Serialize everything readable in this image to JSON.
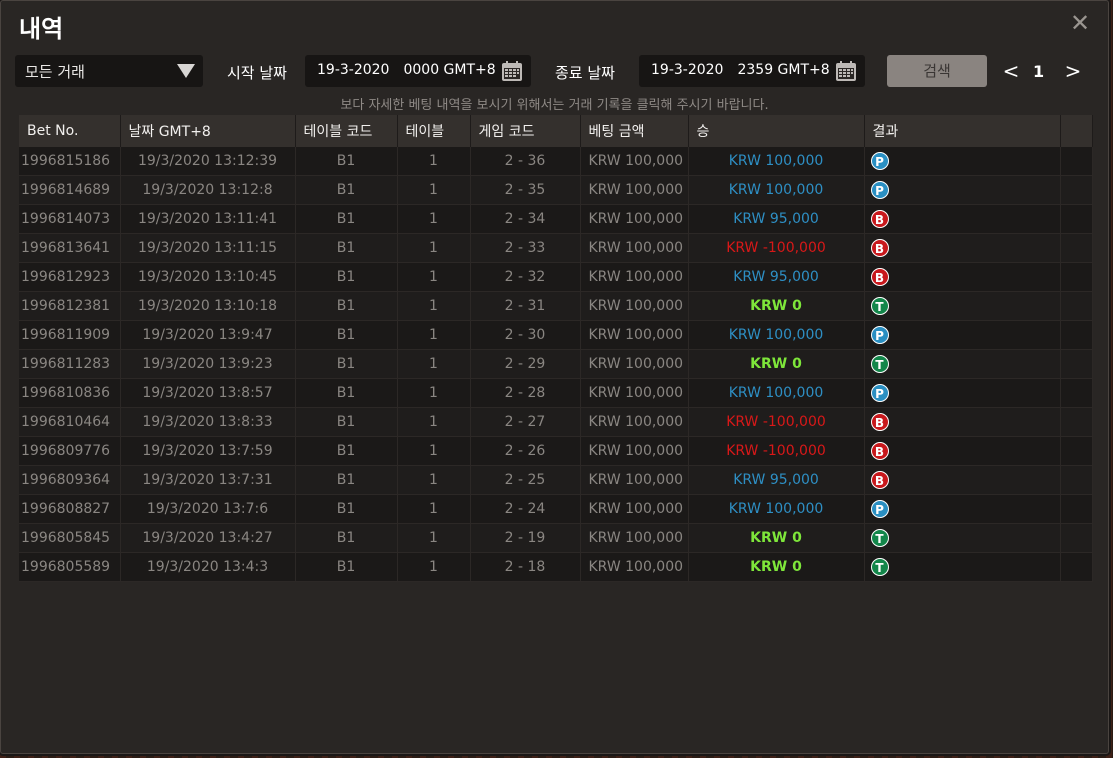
{
  "window": {
    "title": "내역"
  },
  "filters": {
    "type_select": "모든 거래",
    "start_label": "시작 날짜",
    "start_date": "19-3-2020",
    "start_time": "0000 GMT+8",
    "end_label": "종료 날짜",
    "end_date": "19-3-2020",
    "end_time": "2359 GMT+8",
    "search_label": "검색",
    "page": "1",
    "prev": "<",
    "next": ">"
  },
  "hint": "보다 자세한 베팅 내역을 보시기 위해서는 거래 기록을 클릭해 주시기 바랍니다.",
  "table": {
    "headers": [
      "Bet No.",
      "날짜 GMT+8",
      "테이블 코드",
      "테이블",
      "게임 코드",
      "베팅 금액",
      "승",
      "결과"
    ],
    "rows": [
      {
        "bet": "1996815186",
        "date": "19/3/2020 13:12:39",
        "code": "B1",
        "table": "1",
        "game": "2 - 36",
        "amount": "KRW 100,000",
        "win": "KRW 100,000",
        "result": "P"
      },
      {
        "bet": "1996814689",
        "date": "19/3/2020 13:12:8",
        "code": "B1",
        "table": "1",
        "game": "2 - 35",
        "amount": "KRW 100,000",
        "win": "KRW 100,000",
        "result": "P"
      },
      {
        "bet": "1996814073",
        "date": "19/3/2020 13:11:41",
        "code": "B1",
        "table": "1",
        "game": "2 - 34",
        "amount": "KRW 100,000",
        "win": "KRW 95,000",
        "result": "B"
      },
      {
        "bet": "1996813641",
        "date": "19/3/2020 13:11:15",
        "code": "B1",
        "table": "1",
        "game": "2 - 33",
        "amount": "KRW 100,000",
        "win": "KRW -100,000",
        "result": "B"
      },
      {
        "bet": "1996812923",
        "date": "19/3/2020 13:10:45",
        "code": "B1",
        "table": "1",
        "game": "2 - 32",
        "amount": "KRW 100,000",
        "win": "KRW 95,000",
        "result": "B"
      },
      {
        "bet": "1996812381",
        "date": "19/3/2020 13:10:18",
        "code": "B1",
        "table": "1",
        "game": "2 - 31",
        "amount": "KRW 100,000",
        "win": "KRW 0",
        "result": "T"
      },
      {
        "bet": "1996811909",
        "date": "19/3/2020 13:9:47",
        "code": "B1",
        "table": "1",
        "game": "2 - 30",
        "amount": "KRW 100,000",
        "win": "KRW 100,000",
        "result": "P"
      },
      {
        "bet": "1996811283",
        "date": "19/3/2020 13:9:23",
        "code": "B1",
        "table": "1",
        "game": "2 - 29",
        "amount": "KRW 100,000",
        "win": "KRW 0",
        "result": "T"
      },
      {
        "bet": "1996810836",
        "date": "19/3/2020 13:8:57",
        "code": "B1",
        "table": "1",
        "game": "2 - 28",
        "amount": "KRW 100,000",
        "win": "KRW 100,000",
        "result": "P"
      },
      {
        "bet": "1996810464",
        "date": "19/3/2020 13:8:33",
        "code": "B1",
        "table": "1",
        "game": "2 - 27",
        "amount": "KRW 100,000",
        "win": "KRW -100,000",
        "result": "B"
      },
      {
        "bet": "1996809776",
        "date": "19/3/2020 13:7:59",
        "code": "B1",
        "table": "1",
        "game": "2 - 26",
        "amount": "KRW 100,000",
        "win": "KRW -100,000",
        "result": "B"
      },
      {
        "bet": "1996809364",
        "date": "19/3/2020 13:7:31",
        "code": "B1",
        "table": "1",
        "game": "2 - 25",
        "amount": "KRW 100,000",
        "win": "KRW 95,000",
        "result": "B"
      },
      {
        "bet": "1996808827",
        "date": "19/3/2020 13:7:6",
        "code": "B1",
        "table": "1",
        "game": "2 - 24",
        "amount": "KRW 100,000",
        "win": "KRW 100,000",
        "result": "P"
      },
      {
        "bet": "1996805845",
        "date": "19/3/2020 13:4:27",
        "code": "B1",
        "table": "1",
        "game": "2 - 19",
        "amount": "KRW 100,000",
        "win": "KRW 0",
        "result": "T"
      },
      {
        "bet": "1996805589",
        "date": "19/3/2020 13:4:3",
        "code": "B1",
        "table": "1",
        "game": "2 - 18",
        "amount": "KRW 100,000",
        "win": "KRW 0",
        "result": "T"
      }
    ]
  },
  "colors": {
    "win_positive": "#2e8fc4",
    "win_negative": "#d81818",
    "win_zero": "#7ee63a",
    "badge_P": "#2a8fc2",
    "badge_B": "#c8181c",
    "badge_T": "#13864a"
  },
  "icons": {
    "calendar": "calendar-icon",
    "close": "close-icon",
    "dropdown": "chevron-down-icon"
  }
}
